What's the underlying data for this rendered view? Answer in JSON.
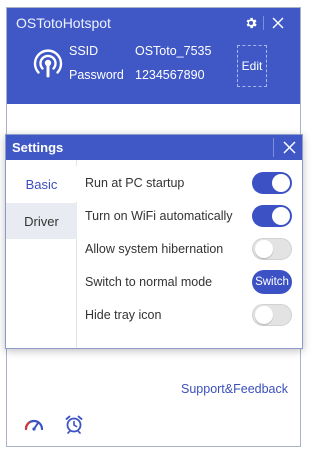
{
  "app": {
    "title": "OSTotoHotspot"
  },
  "hotspot": {
    "ssid_label": "SSID",
    "ssid_value": "OSToto_7535",
    "password_label": "Password",
    "password_value": "1234567890",
    "edit_label": "Edit"
  },
  "footer": {
    "support_label": "Support&Feedback",
    "icons": [
      "speedometer-icon",
      "alarm-clock-icon"
    ]
  },
  "settings": {
    "title": "Settings",
    "tabs": [
      {
        "label": "Basic",
        "active": true
      },
      {
        "label": "Driver",
        "active": false
      }
    ],
    "options": [
      {
        "label": "Run at PC startup",
        "control": "toggle",
        "on": true
      },
      {
        "label": "Turn on WiFi automatically",
        "control": "toggle",
        "on": true
      },
      {
        "label": "Allow system hibernation",
        "control": "toggle",
        "on": false
      },
      {
        "label": "Switch to normal mode",
        "control": "button",
        "button_label": "Switch"
      },
      {
        "label": "Hide tray icon",
        "control": "toggle",
        "on": false
      }
    ]
  },
  "colors": {
    "header_blue": "#4058c6",
    "accent_blue": "#3c52c4",
    "link_blue": "#3b4fbd"
  }
}
